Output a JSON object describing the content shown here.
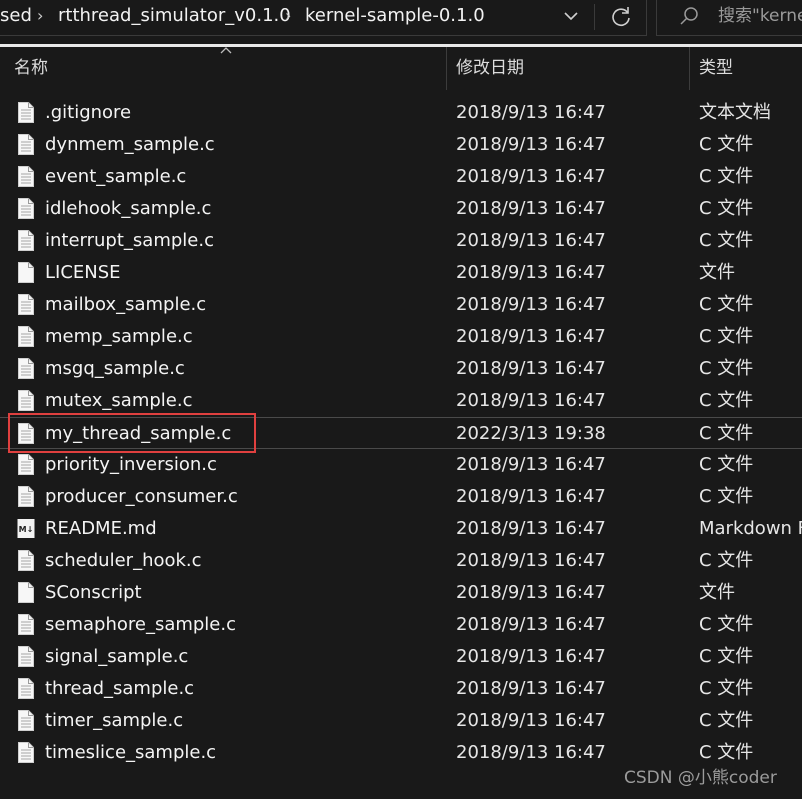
{
  "address_bar": {
    "crumbs": [
      "sed",
      "rtthread_simulator_v0.1.0",
      "kernel-sample-0.1.0"
    ],
    "dropdown_icon": "chevron-down-icon",
    "refresh_icon": "refresh-icon"
  },
  "search": {
    "placeholder": "搜索\"kerne",
    "icon": "search-icon"
  },
  "columns": {
    "name": "名称",
    "modified": "修改日期",
    "type": "类型"
  },
  "files": [
    {
      "name": ".gitignore",
      "date": "2018/9/13 16:47",
      "type": "文本文档",
      "icon": "text-file-icon"
    },
    {
      "name": "dynmem_sample.c",
      "date": "2018/9/13 16:47",
      "type": "C 文件",
      "icon": "c-file-icon"
    },
    {
      "name": "event_sample.c",
      "date": "2018/9/13 16:47",
      "type": "C 文件",
      "icon": "c-file-icon"
    },
    {
      "name": "idlehook_sample.c",
      "date": "2018/9/13 16:47",
      "type": "C 文件",
      "icon": "c-file-icon"
    },
    {
      "name": "interrupt_sample.c",
      "date": "2018/9/13 16:47",
      "type": "C 文件",
      "icon": "c-file-icon"
    },
    {
      "name": "LICENSE",
      "date": "2018/9/13 16:47",
      "type": "文件",
      "icon": "blank-file-icon"
    },
    {
      "name": "mailbox_sample.c",
      "date": "2018/9/13 16:47",
      "type": "C 文件",
      "icon": "c-file-icon"
    },
    {
      "name": "memp_sample.c",
      "date": "2018/9/13 16:47",
      "type": "C 文件",
      "icon": "c-file-icon"
    },
    {
      "name": "msgq_sample.c",
      "date": "2018/9/13 16:47",
      "type": "C 文件",
      "icon": "c-file-icon"
    },
    {
      "name": "mutex_sample.c",
      "date": "2018/9/13 16:47",
      "type": "C 文件",
      "icon": "c-file-icon"
    },
    {
      "name": "my_thread_sample.c",
      "date": "2022/3/13 19:38",
      "type": "C 文件",
      "icon": "c-file-icon"
    },
    {
      "name": "priority_inversion.c",
      "date": "2018/9/13 16:47",
      "type": "C 文件",
      "icon": "c-file-icon"
    },
    {
      "name": "producer_consumer.c",
      "date": "2018/9/13 16:47",
      "type": "C 文件",
      "icon": "c-file-icon"
    },
    {
      "name": "README.md",
      "date": "2018/9/13 16:47",
      "type": "Markdown F",
      "icon": "markdown-file-icon"
    },
    {
      "name": "scheduler_hook.c",
      "date": "2018/9/13 16:47",
      "type": "C 文件",
      "icon": "c-file-icon"
    },
    {
      "name": "SConscript",
      "date": "2018/9/13 16:47",
      "type": "文件",
      "icon": "blank-file-icon"
    },
    {
      "name": "semaphore_sample.c",
      "date": "2018/9/13 16:47",
      "type": "C 文件",
      "icon": "c-file-icon"
    },
    {
      "name": "signal_sample.c",
      "date": "2018/9/13 16:47",
      "type": "C 文件",
      "icon": "c-file-icon"
    },
    {
      "name": "thread_sample.c",
      "date": "2018/9/13 16:47",
      "type": "C 文件",
      "icon": "c-file-icon"
    },
    {
      "name": "timer_sample.c",
      "date": "2018/9/13 16:47",
      "type": "C 文件",
      "icon": "c-file-icon"
    },
    {
      "name": "timeslice_sample.c",
      "date": "2018/9/13 16:47",
      "type": "C 文件",
      "icon": "c-file-icon"
    }
  ],
  "highlighted_file": "my_thread_sample.c",
  "colors": {
    "background": "#191919",
    "text": "#f4f4f4",
    "highlight_border": "#e0403f"
  },
  "watermark": "CSDN @小熊coder"
}
